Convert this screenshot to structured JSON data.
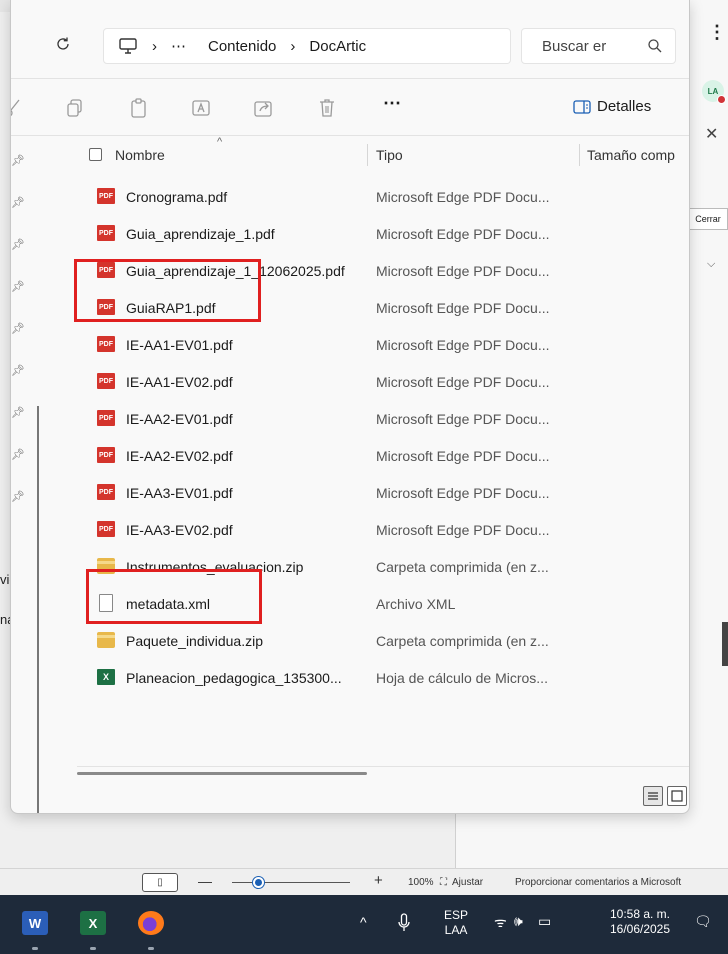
{
  "background_app": {
    "avatar_initials": "LA",
    "close_button_label": "Cerrar",
    "left_fragments": [
      "vic",
      "nal"
    ],
    "more_menu_label": "⋮"
  },
  "explorer": {
    "breadcrumb": {
      "overflow": "⋯",
      "items": [
        "Contenido",
        "DocArtic"
      ]
    },
    "search_placeholder": "Buscar er",
    "toolbar": {
      "more_label": "⋯",
      "details_label": "Detalles"
    },
    "columns": {
      "name": "Nombre",
      "type": "Tipo",
      "size": "Tamaño comp"
    },
    "files": [
      {
        "name": "Cronograma.pdf",
        "type": "Microsoft Edge PDF Docu...",
        "icon": "pdf-icon"
      },
      {
        "name": "Guia_aprendizaje_1.pdf",
        "type": "Microsoft Edge PDF Docu...",
        "icon": "pdf-icon"
      },
      {
        "name": "Guia_aprendizaje_1_12062025.pdf",
        "type": "Microsoft Edge PDF Docu...",
        "icon": "pdf-icon"
      },
      {
        "name": "GuiaRAP1.pdf",
        "type": "Microsoft Edge PDF Docu...",
        "icon": "pdf-icon"
      },
      {
        "name": "IE-AA1-EV01.pdf",
        "type": "Microsoft Edge PDF Docu...",
        "icon": "pdf-icon"
      },
      {
        "name": "IE-AA1-EV02.pdf",
        "type": "Microsoft Edge PDF Docu...",
        "icon": "pdf-icon"
      },
      {
        "name": "IE-AA2-EV01.pdf",
        "type": "Microsoft Edge PDF Docu...",
        "icon": "pdf-icon"
      },
      {
        "name": "IE-AA2-EV02.pdf",
        "type": "Microsoft Edge PDF Docu...",
        "icon": "pdf-icon"
      },
      {
        "name": "IE-AA3-EV01.pdf",
        "type": "Microsoft Edge PDF Docu...",
        "icon": "pdf-icon"
      },
      {
        "name": "IE-AA3-EV02.pdf",
        "type": "Microsoft Edge PDF Docu...",
        "icon": "pdf-icon"
      },
      {
        "name": "Instrumentos_evaluacion.zip",
        "type": "Carpeta comprimida (en z...",
        "icon": "zip-folder-icon"
      },
      {
        "name": "metadata.xml",
        "type": "Archivo XML",
        "icon": "xml-file-icon"
      },
      {
        "name": "Paquete_individua.zip",
        "type": "Carpeta comprimida (en z...",
        "icon": "zip-folder-icon"
      },
      {
        "name": "Planeacion_pedagogica_135300...",
        "type": "Hoja de cálculo de Micros...",
        "icon": "excel-icon"
      }
    ],
    "highlighted_files": [
      "GuiaRAP1.pdf",
      "metadata.xml"
    ]
  },
  "statusbar": {
    "minus": "—",
    "plus": "+",
    "zoom": "100%",
    "fit_label": "Ajustar",
    "feedback": "Proporcionar comentarios a Microsoft"
  },
  "taskbar": {
    "language": "ESP",
    "layout": "LAA",
    "time": "10:58 a. m.",
    "date": "16/06/2025",
    "word_letter": "W",
    "excel_letter": "X"
  },
  "colors": {
    "highlight": "#e02020",
    "taskbar": "#1e2a3a",
    "pdf": "#d4342c"
  }
}
